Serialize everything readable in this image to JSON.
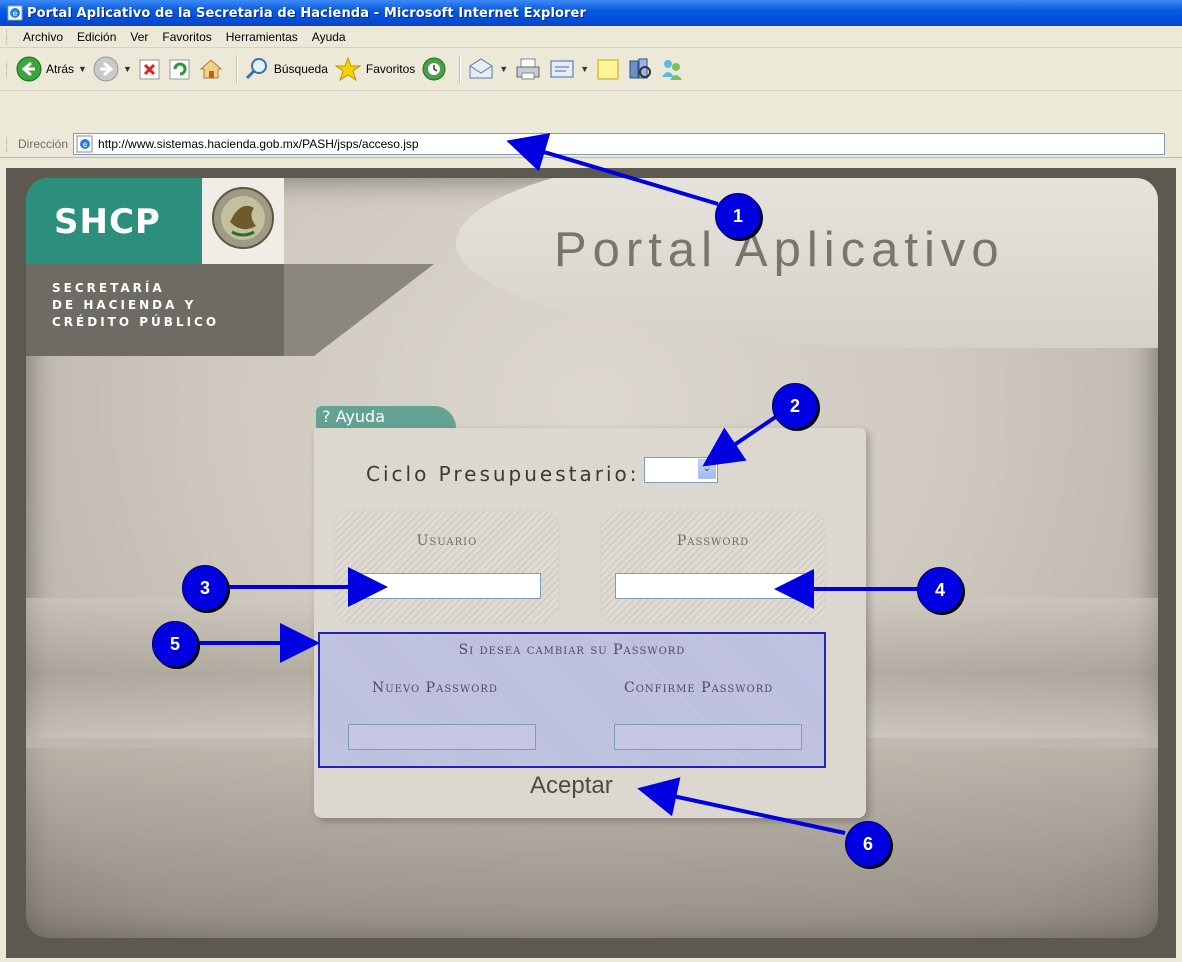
{
  "window": {
    "title": "Portal Aplicativo de la Secretaria de Hacienda - Microsoft Internet Explorer"
  },
  "menu": [
    "Archivo",
    "Edición",
    "Ver",
    "Favoritos",
    "Herramientas",
    "Ayuda"
  ],
  "toolbar": {
    "back_label": "Atrás",
    "search_label": "Búsqueda",
    "favorites_label": "Favoritos"
  },
  "address": {
    "label": "Dirección",
    "url": "http://www.sistemas.hacienda.gob.mx/PASH/jsps/acceso.jsp"
  },
  "logo": {
    "acronym": "SHCP",
    "line1": "SECRETARÍA",
    "line2": "DE HACIENDA Y",
    "line3": "CRÉDITO PÚBLICO"
  },
  "page_title": "Portal Aplicativo",
  "login": {
    "help_tab": "? Ayuda",
    "cycle_label": "Ciclo Presupuestario:",
    "cycle_value": "",
    "user_label": "Usuario",
    "password_label": "Password",
    "change_title": "Si desea cambiar su Password",
    "new_password_label": "Nuevo Password",
    "confirm_password_label": "Confirme Password",
    "accept_label": "Aceptar"
  },
  "annotations": [
    "1",
    "2",
    "3",
    "4",
    "5",
    "6"
  ],
  "colors": {
    "annotation_blue": "#0000e0",
    "logo_green": "#2b8f7c",
    "logo_gray": "#6e6a64",
    "tab_green": "#64a394"
  }
}
